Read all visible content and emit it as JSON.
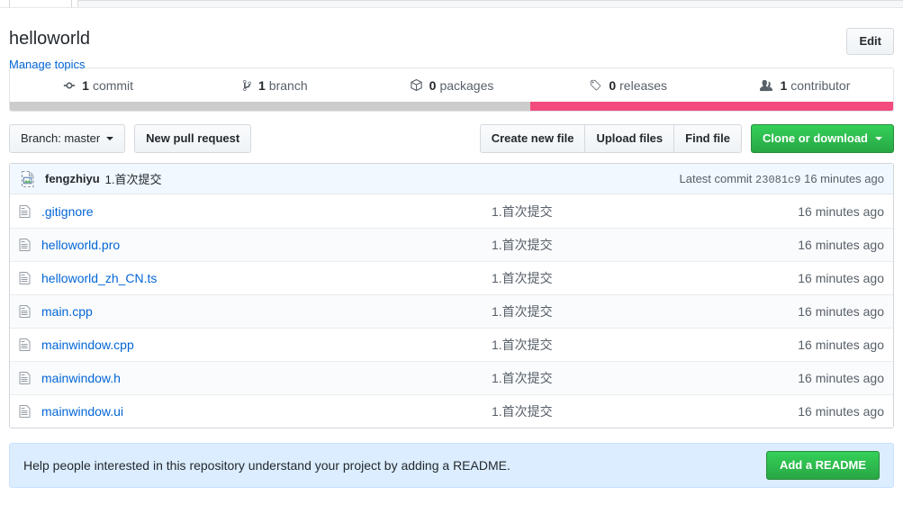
{
  "repo": {
    "name": "helloworld",
    "manage_topics_label": "Manage topics",
    "edit_button_label": "Edit"
  },
  "numbers_nav": [
    {
      "icon": "git-commit-icon",
      "count": "1",
      "label": "commit"
    },
    {
      "icon": "git-branch-icon",
      "count": "1",
      "label": "branch"
    },
    {
      "icon": "package-icon",
      "count": "0",
      "label": "packages"
    },
    {
      "icon": "tag-icon",
      "count": "0",
      "label": "releases"
    },
    {
      "icon": "people-icon",
      "count": "1",
      "label": "contributor"
    }
  ],
  "language_bar": [
    {
      "name": "gray-segment",
      "color": "#cccccc",
      "percent": 58.9
    },
    {
      "name": "pink-segment",
      "color": "#f34b7d",
      "percent": 41.1
    }
  ],
  "toolbar": {
    "branch_label": "Branch: master",
    "new_pull_request_label": "New pull request",
    "create_new_file_label": "Create new file",
    "upload_files_label": "Upload files",
    "find_file_label": "Find file",
    "clone_or_download_label": "Clone or download"
  },
  "latest_commit": {
    "avatar": "broken-image-icon",
    "author": "fengzhiyu",
    "message": "1.首次提交",
    "latest_commit_label": "Latest commit",
    "sha": "23081c9",
    "age": "16 minutes ago"
  },
  "files": [
    {
      "icon": "file-icon",
      "name": ".gitignore",
      "message": "1.首次提交",
      "age": "16 minutes ago"
    },
    {
      "icon": "file-icon",
      "name": "helloworld.pro",
      "message": "1.首次提交",
      "age": "16 minutes ago"
    },
    {
      "icon": "file-icon",
      "name": "helloworld_zh_CN.ts",
      "message": "1.首次提交",
      "age": "16 minutes ago"
    },
    {
      "icon": "file-icon",
      "name": "main.cpp",
      "message": "1.首次提交",
      "age": "16 minutes ago"
    },
    {
      "icon": "file-icon",
      "name": "mainwindow.cpp",
      "message": "1.首次提交",
      "age": "16 minutes ago"
    },
    {
      "icon": "file-icon",
      "name": "mainwindow.h",
      "message": "1.首次提交",
      "age": "16 minutes ago"
    },
    {
      "icon": "file-icon",
      "name": "mainwindow.ui",
      "message": "1.首次提交",
      "age": "16 minutes ago"
    }
  ],
  "readme_prompt": {
    "text": "Help people interested in this repository understand your project by adding a README.",
    "button_label": "Add a README"
  },
  "colors": {
    "link": "#0366d6",
    "green_button": "#28a745",
    "info_banner": "#dbedff",
    "commit_bar": "#f1f8ff",
    "lang_gray": "#cccccc",
    "lang_pink": "#f34b7d"
  }
}
